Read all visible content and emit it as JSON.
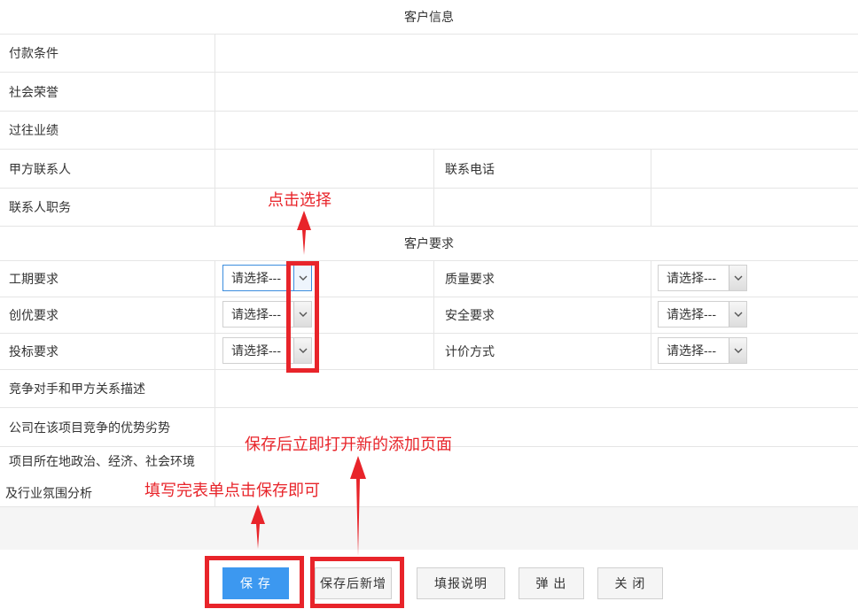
{
  "sections": {
    "customer_info": "客户信息",
    "customer_requirements": "客户要求"
  },
  "fields": {
    "payment_terms": "付款条件",
    "social_honors": "社会荣誉",
    "past_performance": "过往业绩",
    "party_a_contact": "甲方联系人",
    "contact_phone": "联系电话",
    "contact_position": "联系人职务",
    "duration_req": "工期要求",
    "quality_req": "质量要求",
    "excellence_req": "创优要求",
    "safety_req": "安全要求",
    "bid_req": "投标要求",
    "pricing_method": "计价方式",
    "competitor_desc": "竞争对手和甲方关系描述",
    "company_advantage": "公司在该项目竞争的优势劣势",
    "env_line1": "项目所在地政治、经济、社会环境",
    "env_line2": "及行业氛围分析"
  },
  "select_placeholder": "请选择---",
  "buttons": {
    "save": "保 存",
    "save_and_new": "保存后新增",
    "fill_instructions": "填报说明",
    "popup": "弹 出",
    "close": "关 闭"
  },
  "annotations": {
    "click_select": "点击选择",
    "save_open_new": "保存后立即打开新的添加页面",
    "fill_and_save": "填写完表单点击保存即可"
  },
  "colors": {
    "accent": "#3c98f0",
    "annotation": "#e8242a"
  }
}
